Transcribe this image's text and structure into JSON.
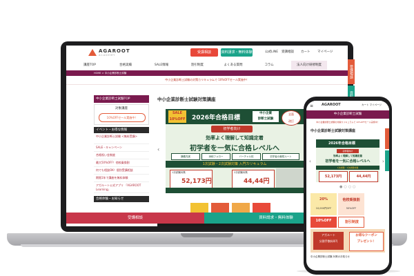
{
  "header": {
    "logo_text": "AGAROOT",
    "logo_sub": "ACADEMY",
    "btn_course": "受講相談",
    "btn_request": "資料請求・無料体験",
    "links": [
      "公式LINE",
      "受講相談",
      "カート",
      "マイページ"
    ]
  },
  "nav": {
    "items": [
      "講座TOP",
      "合格実績",
      "SALE情報",
      "割引制度",
      "よくある質問",
      "コラム",
      "法人向け研修制度"
    ]
  },
  "breadcrumb": "HOME > 中小企業診断士試験",
  "notice": "中小企業診断士試験の対策カリキュラムで 10%OFFセール実施中！",
  "side_tabs": [
    "受講相談",
    "資料請求"
  ],
  "sidebar": {
    "top_label": "中小企業診断士試験TOP",
    "box_title": "対象講座",
    "coupon": "10%OFFセール実施中！",
    "section_events": "イベント・お得な情報",
    "links": [
      "中小企業診断士試験 <無料受講>",
      "SALE・キャンペーン",
      "合格祝い金制度",
      "最大50%OFF！他校乗換割",
      "何でも相談OK！個別受講相談",
      "期限1年で講座を無料体験",
      "アガルート公式アプリ 「AGAROOT Learning」"
    ],
    "section_exam": "合格体験・お知らせ"
  },
  "main": {
    "title": "中小企業診断士試験対策講座",
    "banner": {
      "sale_line1": "SALE",
      "sale_line2": "10%OFF",
      "year_goal": "2026年合格目標",
      "exam_name_1": "中小企業",
      "exam_name_2": "診断士試験",
      "badge_new_1": "全面",
      "badge_new_2": "改訂",
      "tag": "初学者向け",
      "line1": "効率よく理解して知識定着",
      "line2": "初学者を一気に合格レベルへ",
      "chips": [
        "講義充実",
        "添削フォロー",
        "バーチャル校",
        "初学者の最短ルート"
      ],
      "curriculum": "1次試験・2次試験対策 入門カリキュラム",
      "price_a_label": "1次試験対策",
      "price_a": "52,173円",
      "price_b_label": "2次試験対策",
      "price_b": "44,44円"
    }
  },
  "cta": {
    "consult": "受講相談",
    "request": "資料請求・無料体験"
  },
  "phone": {
    "logo_text": "AGAROOT",
    "links": [
      "カート",
      "マイページ"
    ],
    "topbar": "中小企業診断士試験",
    "notice": "中小企業診断士試験の対策カリキュラムで 10%OFFセール実施中！",
    "title": "中小企業診断士試験対策講座",
    "banner_year": "2026年合格目標",
    "banner_tag": "初学者向け",
    "banner_line1": "効率よく理解して知識定着",
    "banner_line2": "初学者を一気に合格レベルへ",
    "banner_curriculum": "1次試験・2次試験対策",
    "price_a": "52,173円",
    "price_b": "44,44円",
    "tiles": [
      {
        "big": "20%",
        "small": "10,000円OFF"
      },
      {
        "big": "他校乗換割",
        "small": "50%OFF"
      },
      {
        "big": "10%OFF",
        "small": "早期割引"
      },
      {
        "big": "割引制度",
        "small": ""
      }
    ],
    "promo_a_1": "アガルート",
    "promo_a_2": "分割手数料0円",
    "promo_b_1": "お得なクーポン",
    "promo_b_2": "プレゼント！",
    "news": "中小企業診断士試験 対策のお知らせ"
  }
}
